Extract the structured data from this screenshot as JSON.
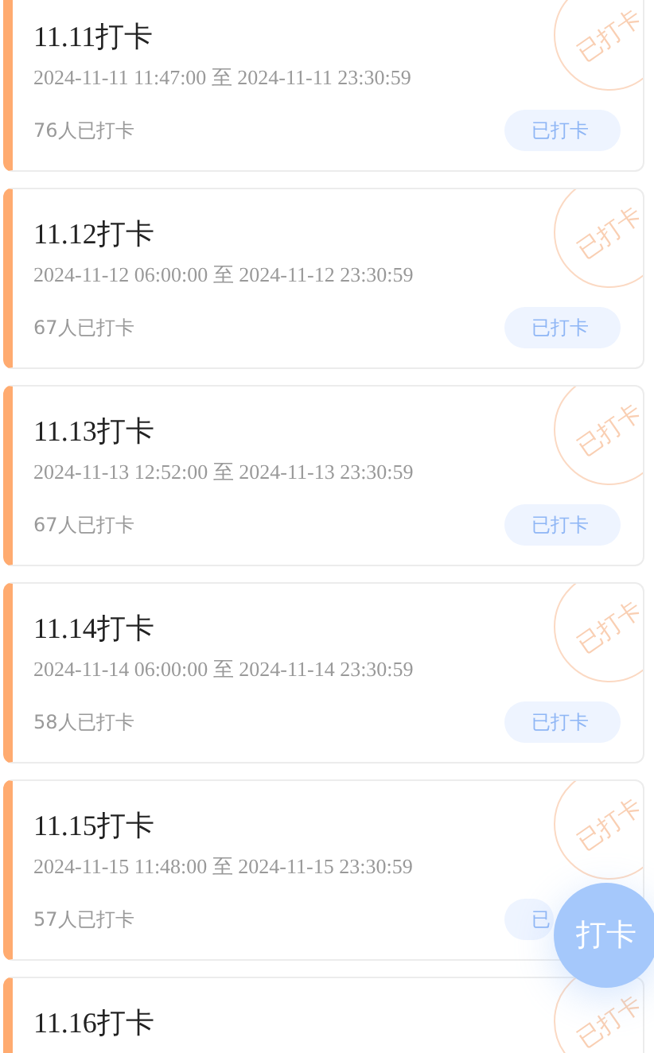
{
  "cards": [
    {
      "title": "11.11打卡",
      "period": "2024-11-11 11:47:00 至 2024-11-11 23:30:59",
      "count": "76人已打卡",
      "status": "已打卡",
      "stamp": "已打卡"
    },
    {
      "title": "11.12打卡",
      "period": "2024-11-12 06:00:00 至 2024-11-12 23:30:59",
      "count": "67人已打卡",
      "status": "已打卡",
      "stamp": "已打卡"
    },
    {
      "title": "11.13打卡",
      "period": "2024-11-13 12:52:00 至 2024-11-13 23:30:59",
      "count": "67人已打卡",
      "status": "已打卡",
      "stamp": "已打卡"
    },
    {
      "title": "11.14打卡",
      "period": "2024-11-14 06:00:00 至 2024-11-14 23:30:59",
      "count": "58人已打卡",
      "status": "已打卡",
      "stamp": "已打卡"
    },
    {
      "title": "11.15打卡",
      "period": "2024-11-15 11:48:00 至 2024-11-15 23:30:59",
      "count": "57人已打卡",
      "status": "已",
      "stamp": "已打卡"
    },
    {
      "title": "11.16打卡",
      "stamp": "已打卡"
    }
  ],
  "fab": {
    "label": "打卡"
  }
}
